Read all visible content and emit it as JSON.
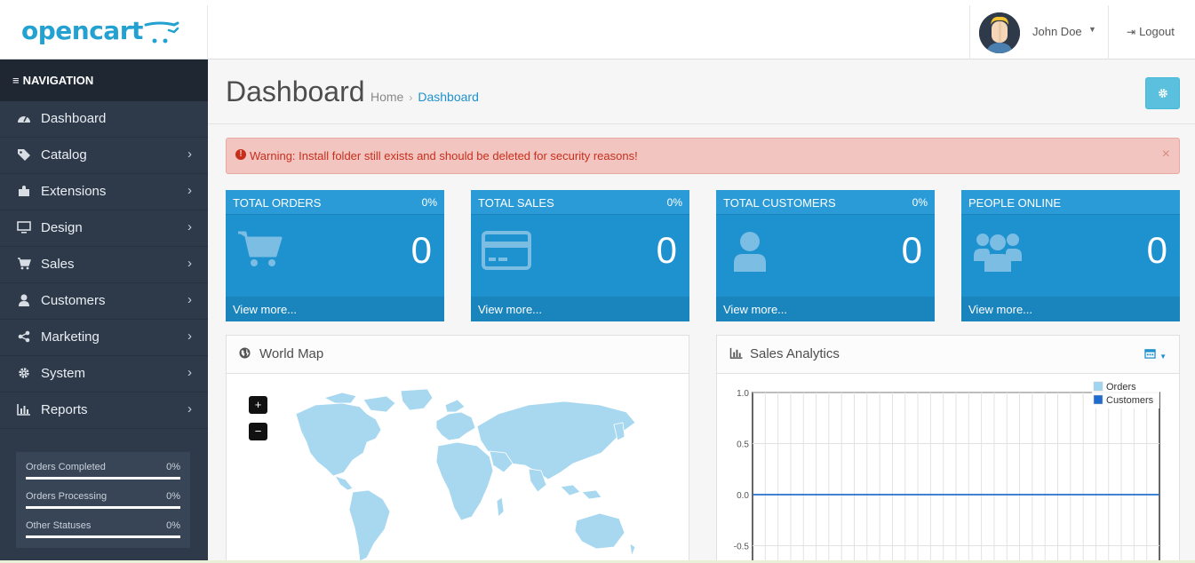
{
  "header": {
    "logo": "opencart",
    "username": "John Doe",
    "logout_label": "Logout"
  },
  "sidebar": {
    "title": "NAVIGATION",
    "items": [
      {
        "label": "Dashboard",
        "icon": "dashboard-icon",
        "has_children": false
      },
      {
        "label": "Catalog",
        "icon": "tags-icon",
        "has_children": true
      },
      {
        "label": "Extensions",
        "icon": "puzzle-icon",
        "has_children": true
      },
      {
        "label": "Design",
        "icon": "monitor-icon",
        "has_children": true
      },
      {
        "label": "Sales",
        "icon": "cart-icon",
        "has_children": true
      },
      {
        "label": "Customers",
        "icon": "user-icon",
        "has_children": true
      },
      {
        "label": "Marketing",
        "icon": "share-icon",
        "has_children": true
      },
      {
        "label": "System",
        "icon": "gear-icon",
        "has_children": true
      },
      {
        "label": "Reports",
        "icon": "bar-chart-icon",
        "has_children": true
      }
    ],
    "progress": [
      {
        "label": "Orders Completed",
        "value": "0%"
      },
      {
        "label": "Orders Processing",
        "value": "0%"
      },
      {
        "label": "Other Statuses",
        "value": "0%"
      }
    ]
  },
  "page": {
    "title": "Dashboard",
    "breadcrumb": {
      "home": "Home",
      "current": "Dashboard"
    }
  },
  "alert": {
    "text": "Warning: Install folder still exists and should be deleted for security reasons!",
    "close": "×"
  },
  "tiles": [
    {
      "title": "TOTAL ORDERS",
      "percent": "0%",
      "value": "0",
      "more": "View more...",
      "icon": "cart-icon"
    },
    {
      "title": "TOTAL SALES",
      "percent": "0%",
      "value": "0",
      "more": "View more...",
      "icon": "credit-card-icon"
    },
    {
      "title": "TOTAL CUSTOMERS",
      "percent": "0%",
      "value": "0",
      "more": "View more...",
      "icon": "user-icon"
    },
    {
      "title": "PEOPLE ONLINE",
      "percent": "",
      "value": "0",
      "more": "View more...",
      "icon": "users-icon"
    }
  ],
  "map_panel": {
    "title": "World Map",
    "zoom_in": "+",
    "zoom_out": "−"
  },
  "chart_panel": {
    "title": "Sales Analytics"
  },
  "colors": {
    "accent": "#1e91cf",
    "sidebar": "#2e3a4a",
    "alert_bg": "#f3c5c0",
    "map_land": "#a8d8f0",
    "orders_series": "#9fd5f0",
    "customers_series": "#1e6cd0"
  },
  "chart_data": {
    "type": "line",
    "series": [
      {
        "name": "Orders",
        "values": [
          0
        ]
      },
      {
        "name": "Customers",
        "values": [
          0
        ]
      }
    ],
    "yticks": [
      "1.0",
      "0.5",
      "0.0",
      "-0.5"
    ],
    "ylim": [
      -0.6,
      1.0
    ],
    "legend": "top-right",
    "grid": true
  }
}
